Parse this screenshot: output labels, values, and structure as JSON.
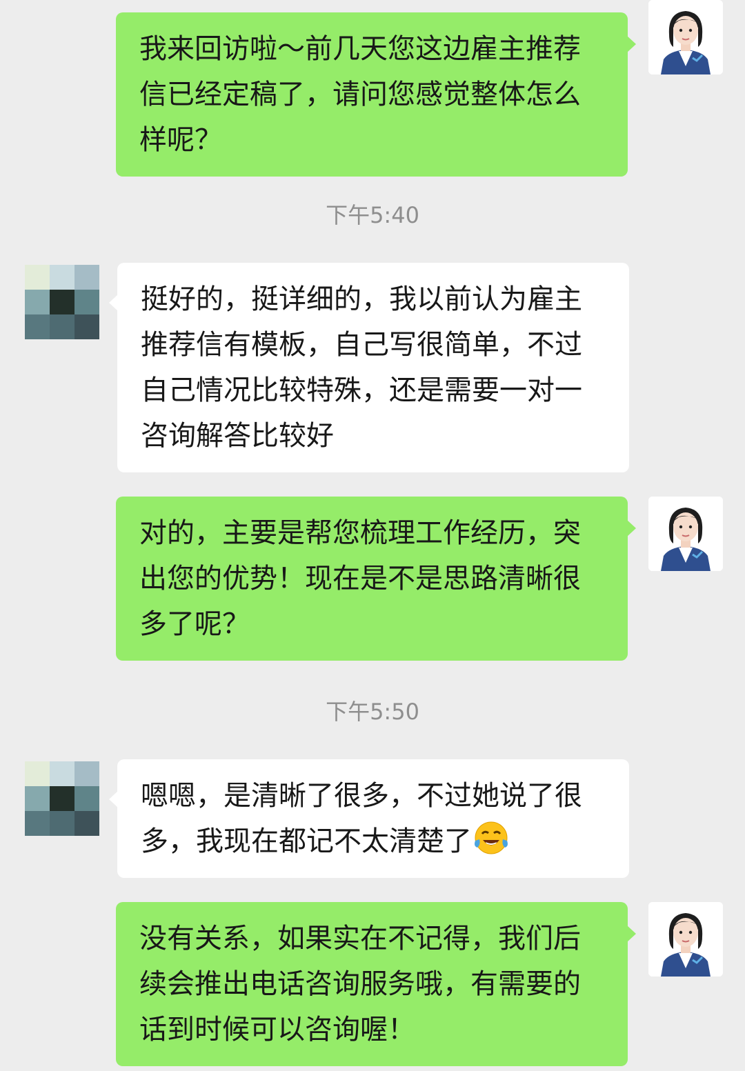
{
  "messages": [
    {
      "text": "我来回访啦～前几天您这边雇主推荐信已经定稿了，请问您感觉整体怎么样呢？"
    },
    {
      "text": "挺好的，挺详细的，我以前认为雇主推荐信有模板，自己写很简单，不过自己情况比较特殊，还是需要一对一咨询解答比较好"
    },
    {
      "text": "对的，主要是帮您梳理工作经历，突出您的优势！现在是不是思路清晰很多了呢？"
    },
    {
      "text": "嗯嗯，是清晰了很多，不过她说了很多，我现在都记不太清楚了",
      "emoji": "face-with-tears-of-joy-icon"
    },
    {
      "text": "没有关系，如果实在不记得，我们后续会推出电话咨询服务哦，有需要的话到时候可以咨询喔！"
    }
  ],
  "timestamps": [
    "下午5:40",
    "下午5:50"
  ],
  "colors": {
    "background": "#ededed",
    "outgoing_bubble": "#95ec69",
    "incoming_bubble": "#ffffff",
    "timestamp_text": "#8e8e8e"
  },
  "icons": {
    "agent_avatar": "agent-avatar-icon",
    "user_avatar": "pixelated-user-avatar"
  }
}
